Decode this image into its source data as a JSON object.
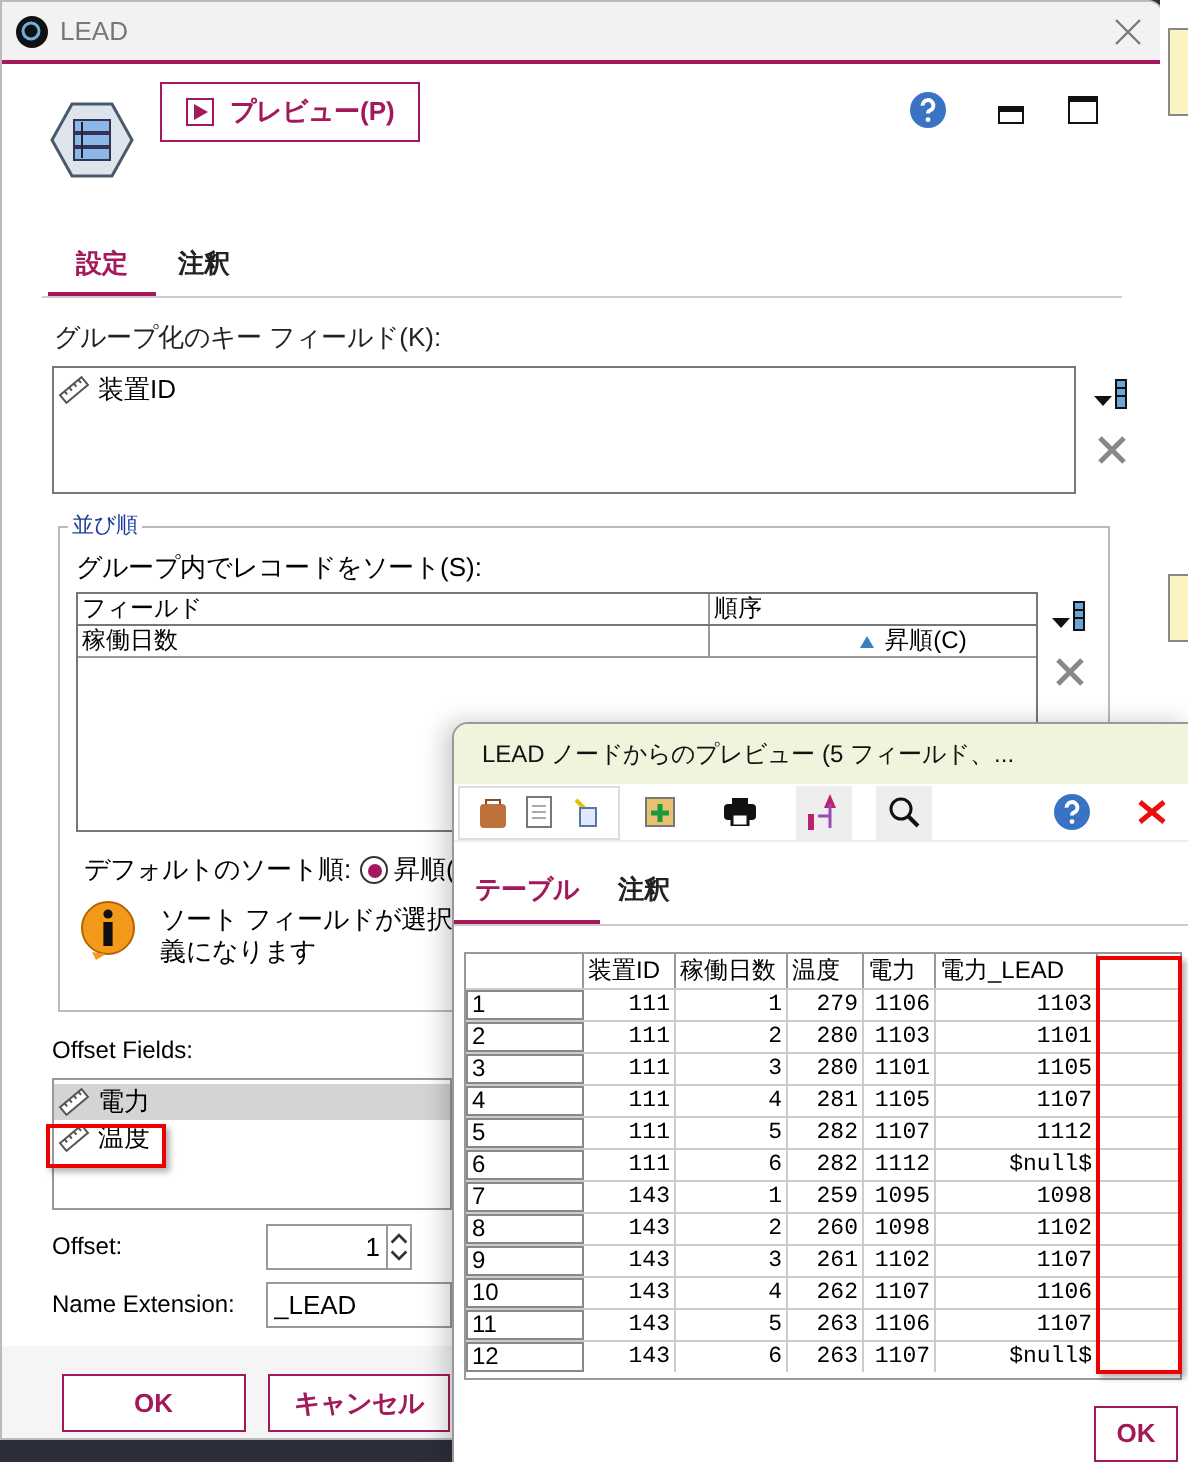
{
  "main_window": {
    "title": "LEAD",
    "preview_button": "プレビュー(P)",
    "tabs": [
      {
        "label": "設定",
        "selected": true
      },
      {
        "label": "注釈",
        "selected": false
      }
    ],
    "key_fields": {
      "label": "グループ化のキー フィールド(K):",
      "items": [
        "装置ID"
      ]
    },
    "sort_group": {
      "title": "並び順",
      "label": "グループ内でレコードをソート(S):",
      "columns": [
        "フィールド",
        "順序"
      ],
      "rows": [
        {
          "field": "稼働日数",
          "order": "昇順(C)"
        }
      ],
      "default_order_label": "デフォルトのソート順:",
      "default_order_options": [
        {
          "label": "昇順(",
          "selected": true
        }
      ],
      "info_lines": [
        "ソート フィールドが選択",
        "義になります"
      ]
    },
    "offset_fields": {
      "label": "Offset Fields:",
      "items": [
        {
          "name": "電力",
          "selected": true,
          "highlighted": false
        },
        {
          "name": "温度",
          "selected": false,
          "highlighted": true
        }
      ]
    },
    "offset": {
      "label": "Offset:",
      "value": "1"
    },
    "name_extension": {
      "label": "Name Extension:",
      "value": "_LEAD"
    },
    "buttons": [
      "OK",
      "キャンセル"
    ]
  },
  "preview_window": {
    "title": "LEAD ノードからのプレビュー (5 フィールド、...",
    "tabs": [
      {
        "label": "テーブル",
        "selected": true
      },
      {
        "label": "注釈",
        "selected": false
      }
    ],
    "table": {
      "columns": [
        "装置ID",
        "稼働日数",
        "温度",
        "電力",
        "電力_LEAD"
      ],
      "extra_column_highlighted": true,
      "rows": [
        {
          "label": "1",
          "cells": [
            "111",
            "1",
            "279",
            "1106",
            "1103"
          ]
        },
        {
          "label": "2",
          "cells": [
            "111",
            "2",
            "280",
            "1103",
            "1101"
          ]
        },
        {
          "label": "3",
          "cells": [
            "111",
            "3",
            "280",
            "1101",
            "1105"
          ]
        },
        {
          "label": "4",
          "cells": [
            "111",
            "4",
            "281",
            "1105",
            "1107"
          ]
        },
        {
          "label": "5",
          "cells": [
            "111",
            "5",
            "282",
            "1107",
            "1112"
          ]
        },
        {
          "label": "6",
          "cells": [
            "111",
            "6",
            "282",
            "1112",
            "$null$"
          ]
        },
        {
          "label": "7",
          "cells": [
            "143",
            "1",
            "259",
            "1095",
            "1098"
          ]
        },
        {
          "label": "8",
          "cells": [
            "143",
            "2",
            "260",
            "1098",
            "1102"
          ]
        },
        {
          "label": "9",
          "cells": [
            "143",
            "3",
            "261",
            "1102",
            "1107"
          ]
        },
        {
          "label": "10",
          "cells": [
            "143",
            "4",
            "262",
            "1107",
            "1106"
          ]
        },
        {
          "label": "11",
          "cells": [
            "143",
            "5",
            "263",
            "1106",
            "1107"
          ]
        },
        {
          "label": "12",
          "cells": [
            "143",
            "6",
            "263",
            "1107",
            "$null$"
          ]
        }
      ]
    },
    "buttons": [
      "OK"
    ]
  }
}
